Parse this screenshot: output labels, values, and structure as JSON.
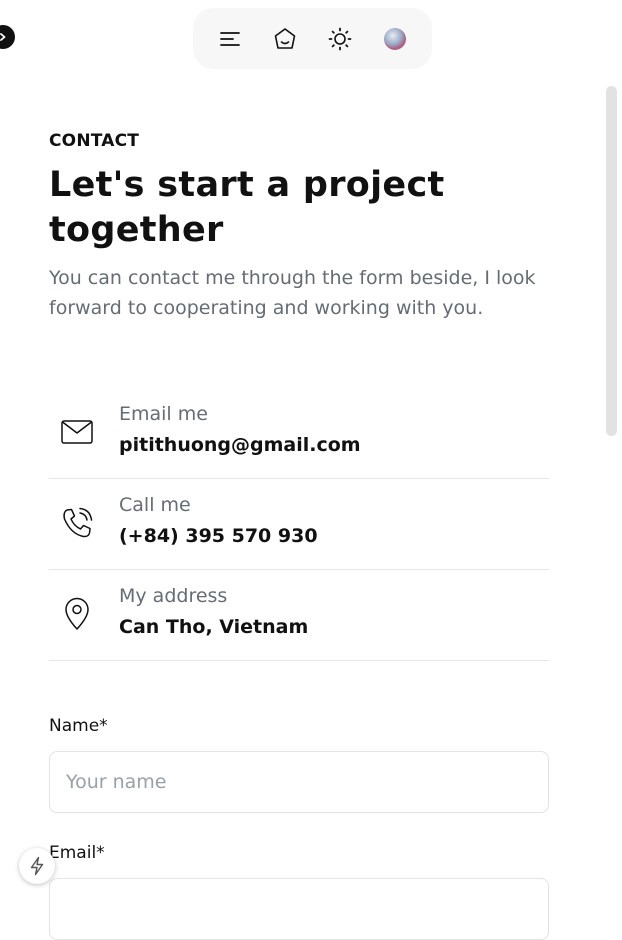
{
  "nav": {
    "icons": [
      "menu-icon",
      "home-icon",
      "sun-icon",
      "avatar"
    ]
  },
  "contact": {
    "eyebrow": "CONTACT",
    "title": "Let's start a project together",
    "lead": "You can contact me through the form beside, I look forward to cooperating and working with you."
  },
  "info": [
    {
      "icon": "mail-icon",
      "label": "Email me",
      "value": "pitithuong@gmail.com"
    },
    {
      "icon": "phone-icon",
      "label": "Call me",
      "value": "(+84) 395 570 930"
    },
    {
      "icon": "map-pin-icon",
      "label": "My address",
      "value": "Can Tho, Vietnam"
    }
  ],
  "form": {
    "name_label": "Name*",
    "name_placeholder": "Your name",
    "email_label": "Email*"
  }
}
